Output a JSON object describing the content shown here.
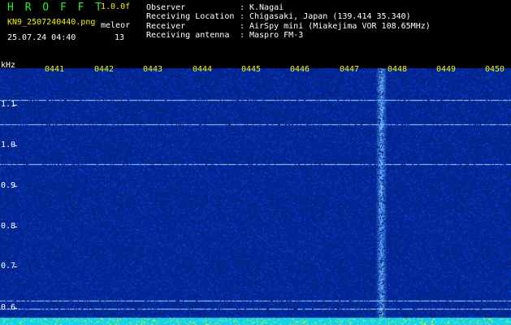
{
  "header": {
    "app_name": "H R O F F T",
    "version": "1.0.0f",
    "filename": "KN9_2507240440.png",
    "timestamp": "25.07.24 04:40",
    "mode": "meleor",
    "count": "13"
  },
  "info": [
    {
      "key": "Observer",
      "sep": ":",
      "value": "K.Nagai"
    },
    {
      "key": "Receiving Location",
      "sep": ":",
      "value": "Chigasaki, Japan (139.414 35.340)"
    },
    {
      "key": "Receiver",
      "sep": ":",
      "value": "AirSpy mini (Miakejima VOR 108.65MHz)"
    },
    {
      "key": "Receiving antenna",
      "sep": ":",
      "value": "Maspro FM-3"
    }
  ],
  "axis": {
    "unit": "kHz",
    "freq_ticks": [
      "1.1",
      "1.0",
      "0.9",
      "0.8",
      "0.7",
      "0.6"
    ],
    "freq_values": [
      1.1,
      1.0,
      0.9,
      0.8,
      0.7,
      0.6
    ],
    "time_ticks": [
      "0441",
      "0442",
      "0443",
      "0444",
      "0445",
      "0446",
      "0447",
      "0448",
      "0449",
      "0450"
    ]
  },
  "colors": {
    "background": "#000000",
    "spectrum_base": "#0a1a8c",
    "signal_line": "#9fe8ff",
    "meteor_echo": "#a8d8ff",
    "baseline": "#22ddee",
    "tick_label": "#f2f200",
    "title_green": "#22ee33"
  }
}
